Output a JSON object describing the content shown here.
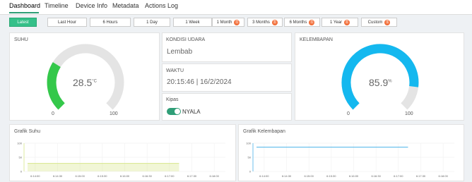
{
  "nav": {
    "tabs": [
      "Dashboard",
      "Timeline",
      "Device Info",
      "Metadata",
      "Actions Log"
    ],
    "active": "Dashboard"
  },
  "ranges": [
    {
      "label": "Latest",
      "locked": false,
      "active": true
    },
    {
      "label": "Last Hour",
      "locked": false,
      "active": false
    },
    {
      "label": "6 Hours",
      "locked": false,
      "active": false
    },
    {
      "label": "1 Day",
      "locked": false,
      "active": false
    },
    {
      "label": "1 Week",
      "locked": false,
      "active": false
    },
    {
      "label": "1 Month",
      "locked": true,
      "active": false
    },
    {
      "label": "3 Months",
      "locked": true,
      "active": false
    },
    {
      "label": "6 Months",
      "locked": true,
      "active": false
    },
    {
      "label": "1 Year",
      "locked": true,
      "active": false
    },
    {
      "label": "Custom",
      "locked": true,
      "active": false
    }
  ],
  "suhu": {
    "title": "SUHU",
    "value": "28.5",
    "unit": "°C",
    "min": "0",
    "max": "100",
    "color": "#34c84a",
    "fraction": 0.285
  },
  "kondisi": {
    "title": "KONDISI UDARA",
    "value": "Lembab"
  },
  "waktu": {
    "title": "WAKTU",
    "value": "20:15:46 | 16/2/2024"
  },
  "kipas": {
    "title": "Kipas",
    "state": "NYALA",
    "on": true
  },
  "kelembapan": {
    "title": "KELEMBAPAN",
    "value": "85.9",
    "unit": "%",
    "min": "0",
    "max": "100",
    "color": "#14b8ef",
    "fraction": 0.859
  },
  "grafik_suhu": {
    "title": "Grafik Suhu",
    "y_ticks": [
      "100",
      "50",
      "0"
    ],
    "x_ticks": [
      "6:14:00",
      "6:14:30",
      "6:15:00",
      "6:15:30",
      "6:16:00",
      "6:16:30",
      "6:17:00",
      "6:17:30",
      "6:18:00"
    ],
    "level": 28.5,
    "color": "#d6e68a"
  },
  "grafik_kelembapan": {
    "title": "Grafik Kelembapan",
    "y_ticks": [
      "100",
      "50",
      "0"
    ],
    "x_ticks": [
      "6:14:00",
      "6:14:30",
      "6:15:00",
      "6:15:30",
      "6:16:00",
      "6:16:30",
      "6:17:00",
      "6:17:30",
      "6:18:00"
    ],
    "level": 85.9,
    "color": "#4ab3e8"
  }
}
